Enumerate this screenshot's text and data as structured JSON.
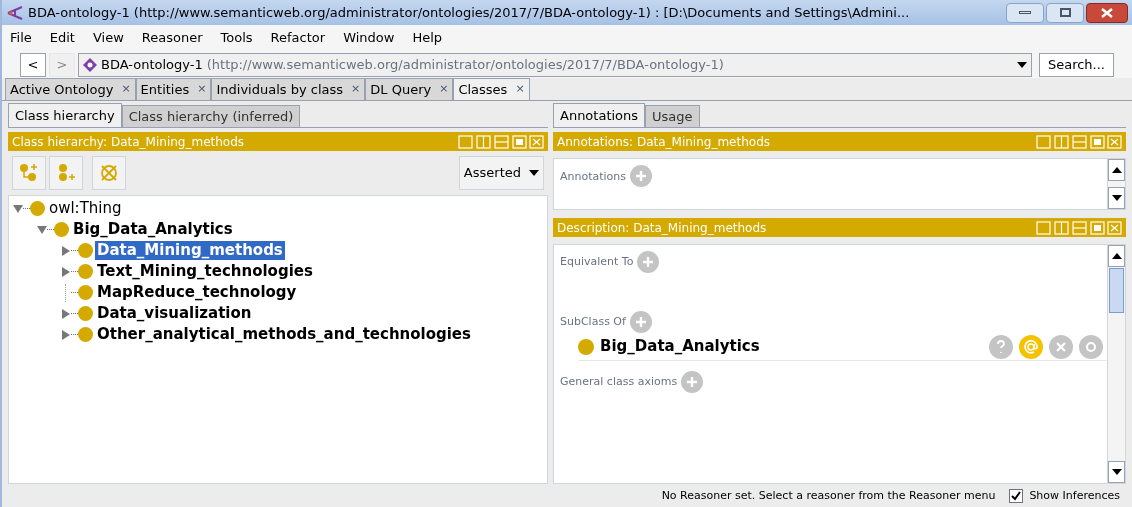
{
  "window": {
    "title": "BDA-ontology-1 (http://www.semanticweb.org/administrator/ontologies/2017/7/BDA-ontology-1)  : [D:\\Documents and Settings\\Admini..."
  },
  "menu": [
    "File",
    "Edit",
    "View",
    "Reasoner",
    "Tools",
    "Refactor",
    "Window",
    "Help"
  ],
  "nav": {
    "back": "<",
    "forward": ">",
    "ontology_name": "BDA-ontology-1",
    "ontology_iri": "(http://www.semanticweb.org/administrator/ontologies/2017/7/BDA-ontology-1)",
    "search": "Search..."
  },
  "tabs": [
    {
      "label": "Active Ontology",
      "close": "×",
      "selected": false
    },
    {
      "label": "Entities",
      "close": "×",
      "selected": false
    },
    {
      "label": "Individuals by class",
      "close": "×",
      "selected": false
    },
    {
      "label": "DL Query",
      "close": "×",
      "selected": false
    },
    {
      "label": "Classes",
      "close": "×",
      "selected": true
    }
  ],
  "left": {
    "tabs": [
      {
        "label": "Class hierarchy",
        "selected": true
      },
      {
        "label": "Class hierarchy (inferred)",
        "selected": false
      }
    ],
    "header": "Class hierarchy: Data_Mining_methods",
    "mode": "Asserted",
    "tree": [
      {
        "label": "owl:Thing",
        "kind": "expanded",
        "bold": false,
        "selected": false,
        "children": [
          {
            "label": "Big_Data_Analytics",
            "kind": "expanded",
            "bold": true,
            "selected": false,
            "children": [
              {
                "label": "Data_Mining_methods",
                "kind": "collapsed",
                "bold": true,
                "selected": true
              },
              {
                "label": "Text_Mining_technologies",
                "kind": "collapsed",
                "bold": true,
                "selected": false
              },
              {
                "label": "MapReduce_technology",
                "kind": "leaf",
                "bold": true,
                "selected": false
              },
              {
                "label": "Data_visualization",
                "kind": "collapsed",
                "bold": true,
                "selected": false
              },
              {
                "label": "Other_analytical_methods_and_technologies",
                "kind": "collapsed",
                "bold": true,
                "selected": false
              }
            ]
          }
        ]
      }
    ]
  },
  "right": {
    "tabs": [
      {
        "label": "Annotations",
        "selected": true
      },
      {
        "label": "Usage",
        "selected": false
      }
    ],
    "annotations_header": "Annotations: Data_Mining_methods",
    "annotations_label": "Annotations",
    "description_header": "Description: Data_Mining_methods",
    "sections": [
      {
        "label": "Equivalent To"
      },
      {
        "label": "SubClass Of",
        "items": [
          "Big_Data_Analytics"
        ]
      },
      {
        "label": "General class axioms"
      }
    ]
  },
  "status": {
    "message": "No Reasoner set. Select a reasoner from the Reasoner menu",
    "show_inferences": {
      "label": "Show Inferences",
      "checked": true
    }
  }
}
